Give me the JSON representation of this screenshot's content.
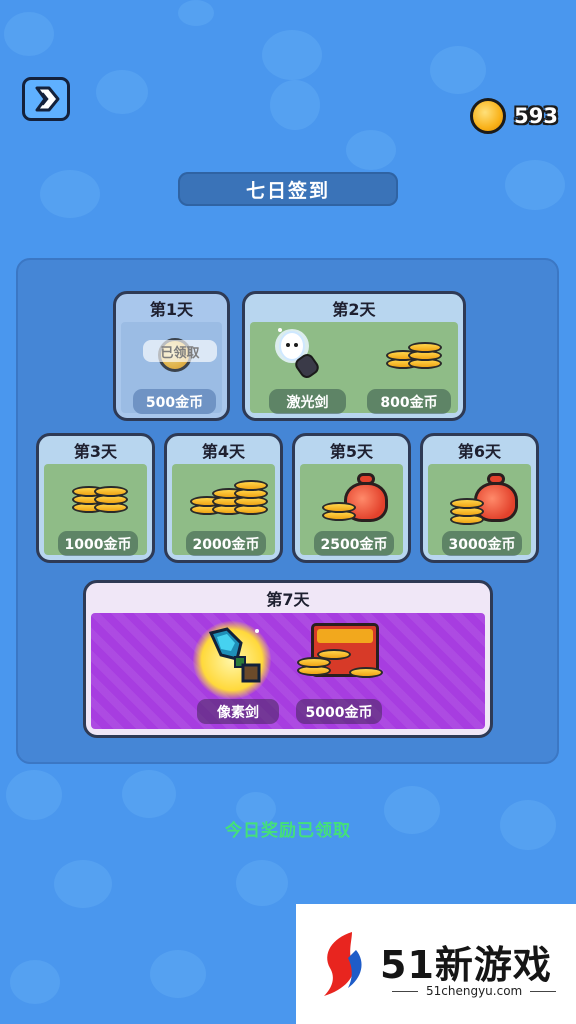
{
  "header": {
    "coin_balance": "593"
  },
  "title": "七日签到",
  "days": [
    {
      "label": "第1天",
      "state": "claimed",
      "badge": "已领取",
      "rewards": [
        {
          "icon": "coin-icon",
          "name": "500金币"
        }
      ]
    },
    {
      "label": "第2天",
      "rewards": [
        {
          "icon": "laser-sword-icon",
          "name": "激光剑"
        },
        {
          "icon": "coin-stack-icon",
          "name": "800金币"
        }
      ]
    },
    {
      "label": "第3天",
      "rewards": [
        {
          "icon": "coin-stack-icon",
          "name": "1000金币"
        }
      ]
    },
    {
      "label": "第4天",
      "rewards": [
        {
          "icon": "coin-stack-icon",
          "name": "2000金币"
        }
      ]
    },
    {
      "label": "第5天",
      "rewards": [
        {
          "icon": "money-bag-icon",
          "name": "2500金币"
        }
      ]
    },
    {
      "label": "第6天",
      "rewards": [
        {
          "icon": "money-bag-icon",
          "name": "3000金币"
        }
      ]
    },
    {
      "label": "第7天",
      "rewards": [
        {
          "icon": "pixel-sword-icon",
          "name": "像素剑"
        },
        {
          "icon": "treasure-chest-icon",
          "name": "5000金币"
        }
      ]
    }
  ],
  "status_message": "今日奖励已领取",
  "watermark": {
    "brand": "51新游戏",
    "url": "51chengyu.com"
  },
  "colors": {
    "background": "#4a97ee",
    "status_green": "#44e07a",
    "day7_purple": "#a73de0",
    "card_green": "#8fbc87"
  }
}
